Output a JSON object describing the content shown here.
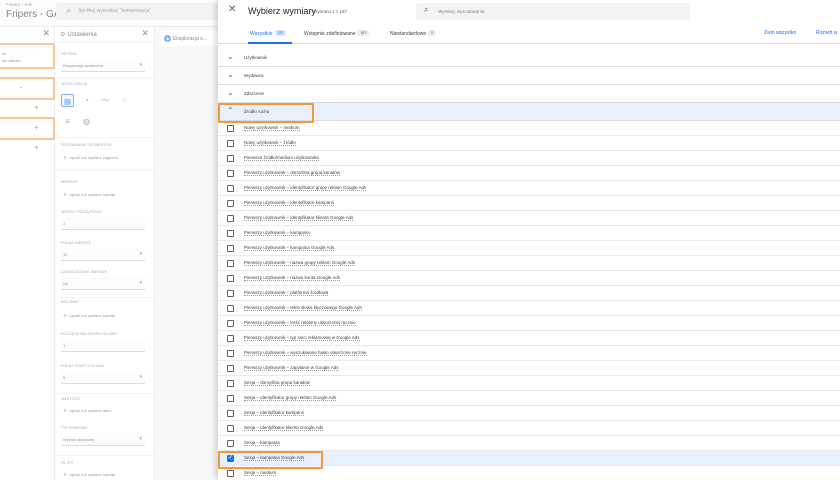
{
  "topbar": {
    "breadcrumb": "Fripers - Jolk",
    "property_name": "Fripers - GA4",
    "search_placeholder": "Spróbuj wyszukać \"konwersacja\""
  },
  "variables_panel": {
    "items": [
      {
        "label": "ac"
      },
      {
        "label": "nik zakres..."
      }
    ]
  },
  "settings": {
    "title": "Ustawienia",
    "sections": {
      "method_label": "METODA",
      "method_value": "Eksploracja swobodna",
      "visualization_label": "WIZUALIZACJA",
      "segment_compare_label": "PORÓWNANIE SEGMENTÓW",
      "segment_add": "Upuść lub wybierz segment",
      "rows_label": "WIERSZE",
      "rows_add": "Upuść lub wybierz wymiar",
      "first_row_label": "WIERSZ POCZĄTKOWY",
      "first_row_value": "1",
      "show_rows_label": "POKAŻ WIERSZE",
      "show_rows_value": "10",
      "nested_rows_label": "ZAGNIEŻDŻONE WIERSZE",
      "nested_rows_value": "No",
      "columns_label": "KOLUMNY",
      "columns_add": "Upuść lub wybierz wymiar",
      "first_col_label": "POCZĄTKOWA GRUPA KOLUMN",
      "first_col_value": "1",
      "show_cols_label": "POKAŻ GRUPY KOLUMN",
      "show_cols_value": "5",
      "values_label": "WARTOŚCI",
      "values_add": "Upuść lub wybierz dane",
      "cell_type_label": "TYP KOMÓREK",
      "cell_type_value": "Wykres słupkowy",
      "filters_label": "FILTRY",
      "filters_add": "Upuść lub wybierz wymiar"
    }
  },
  "tab_strip": {
    "tab_label": "Eksploracja s..."
  },
  "dialog": {
    "title": "Wybierz wymiary",
    "subtitle": "Wybrano 1 z 187",
    "search_placeholder": "Wymiary wyszukiwania",
    "tabs": [
      {
        "label": "Wszystkie",
        "count": "187"
      },
      {
        "label": "Wstępnie zdefiniowane",
        "count": "187"
      },
      {
        "label": "Niestandardowe",
        "count": "0"
      }
    ],
    "collapse_all": "Zwiń wszystko",
    "expand_all": "Rozwiń w",
    "categories": [
      {
        "label": "Użytkownik",
        "open": false
      },
      {
        "label": "Wydawca",
        "open": false
      },
      {
        "label": "Zdarzenie",
        "open": false
      },
      {
        "label": "Źródło ruchu",
        "open": true
      }
    ],
    "items": [
      {
        "label": "Nowy użytkownik – medium",
        "checked": false
      },
      {
        "label": "Nowy użytkownik – źródło",
        "checked": false
      },
      {
        "label": "Pierwsze źródło/medium użytkownika",
        "checked": false
      },
      {
        "label": "Pierwszy użytkownik – domyślna grupa kanałów",
        "checked": false
      },
      {
        "label": "Pierwszy użytkownik – identyfikator grupy reklam Google Ads",
        "checked": false
      },
      {
        "label": "Pierwszy użytkownik – identyfikator kampanii",
        "checked": false
      },
      {
        "label": "Pierwszy użytkownik – identyfikator klienta Google Ads",
        "checked": false
      },
      {
        "label": "Pierwszy użytkownik – kampania",
        "checked": false
      },
      {
        "label": "Pierwszy użytkownik – kampania Google Ads",
        "checked": false
      },
      {
        "label": "Pierwszy użytkownik – nazwa grupy reklam Google Ads",
        "checked": false
      },
      {
        "label": "Pierwszy użytkownik – nazwa konta Google Ads",
        "checked": false
      },
      {
        "label": "Pierwszy użytkownik – platforma źródłowa",
        "checked": false
      },
      {
        "label": "Pierwszy użytkownik – tekst słowa kluczowego Google Ads",
        "checked": false
      },
      {
        "label": "Pierwszy użytkownik – treść reklamy utworzonej ręcznie",
        "checked": false
      },
      {
        "label": "Pierwszy użytkownik – typ sieci reklamowej w Google Ads",
        "checked": false
      },
      {
        "label": "Pierwszy użytkownik – wyszukiwane hasło utworzone ręcznie",
        "checked": false
      },
      {
        "label": "Pierwszy użytkownik – zapytanie w Google Ads",
        "checked": false
      },
      {
        "label": "Sesja – domyślna grupa kanałów",
        "checked": false
      },
      {
        "label": "Sesja – identyfikator grupy reklam Google Ads",
        "checked": false
      },
      {
        "label": "Sesja – identyfikator kampanii",
        "checked": false
      },
      {
        "label": "Sesja – identyfikator klienta Google Ads",
        "checked": false
      },
      {
        "label": "Sesja – kampania",
        "checked": false
      },
      {
        "label": "Sesja – kampania Google Ads",
        "checked": true
      },
      {
        "label": "Sesja – medium",
        "checked": false
      }
    ]
  }
}
